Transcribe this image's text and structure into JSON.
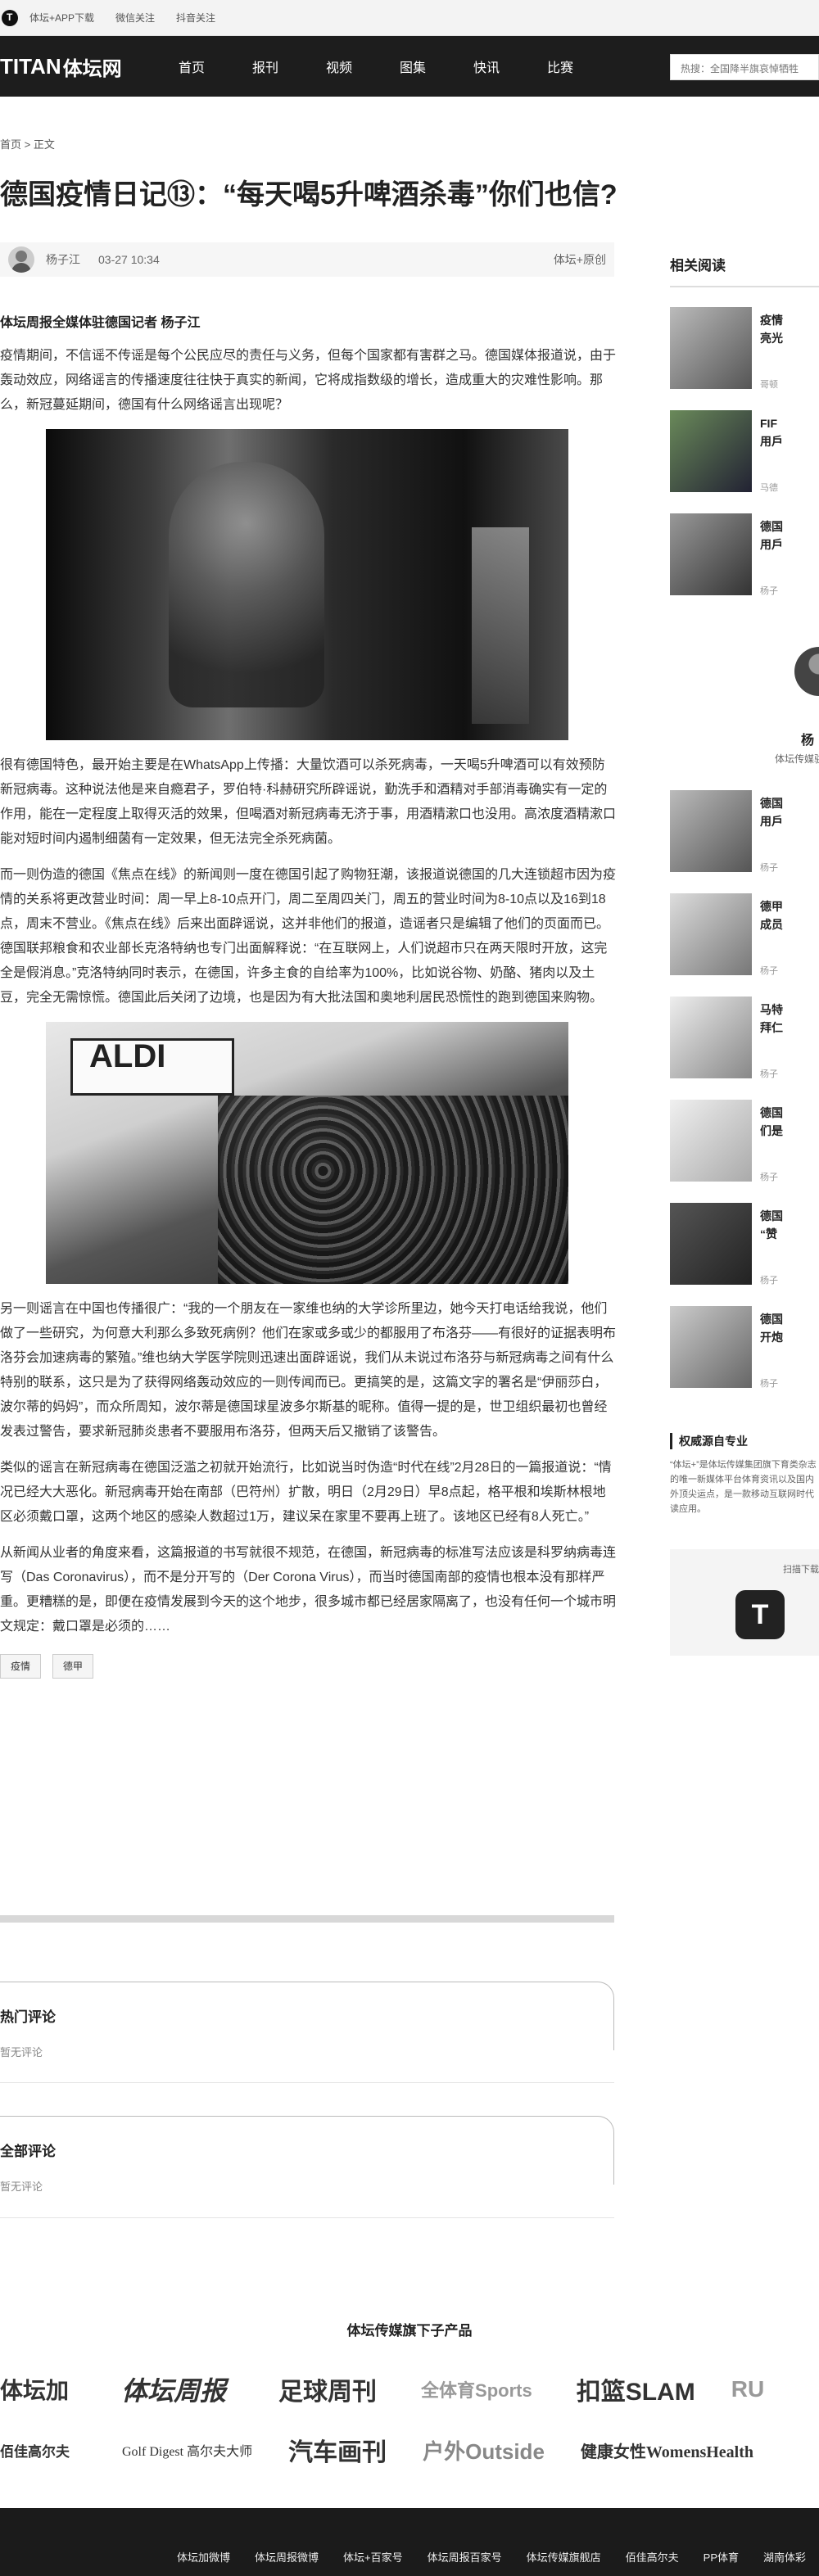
{
  "topbar": {
    "links": [
      "体坛+APP下载",
      "微信关注",
      "抖音关注"
    ]
  },
  "nav": {
    "brand_en": "TITAN",
    "brand_cn": "体坛网",
    "items": [
      "首页",
      "报刊",
      "视频",
      "图集",
      "快讯",
      "比赛"
    ],
    "search_placeholder": "热搜：全国降半旗哀悼牺牲"
  },
  "breadcrumb": "首页 > 正文",
  "article": {
    "title": "德国疫情日记⑬：“每天喝5升啤酒杀毒”你们也信?",
    "author": "杨子江",
    "time": "03-27 10:34",
    "source": "体坛+原创",
    "lead": "体坛周报全媒体驻德国记者 杨子江",
    "paragraphs": [
      "疫情期间，不信谣不传谣是每个公民应尽的责任与义务，但每个国家都有害群之马。德国媒体报道说，由于轰动效应，网络谣言的传播速度往往快于真实的新闻，它将成指数级的增长，造成重大的灾难性影响。那么，新冠蔓延期间，德国有什么网络谣言出现呢？",
      "很有德国特色，最开始主要是在WhatsApp上传播：大量饮酒可以杀死病毒，一天喝5升啤酒可以有效预防新冠病毒。这种说法他是来自瘾君子，罗伯特·科赫研究所辟谣说，勤洗手和酒精对手部消毒确实有一定的作用，能在一定程度上取得灭活的效果，但喝酒对新冠病毒无济于事，用酒精漱口也没用。高浓度酒精漱口能对短时间内遏制细菌有一定效果，但无法完全杀死病菌。",
      "而一则伪造的德国《焦点在线》的新闻则一度在德国引起了购物狂潮，该报道说德国的几大连锁超市因为疫情的关系将更改营业时间：周一早上8-10点开门，周二至周四关门，周五的营业时间为8-10点以及16到18点，周末不营业。《焦点在线》后来出面辟谣说，这并非他们的报道，造谣者只是编辑了他们的页面而已。德国联邦粮食和农业部长克洛特纳也专门出面解释说：“在互联网上，人们说超市只在两天限时开放，这完全是假消息。”克洛特纳同时表示，在德国，许多主食的自给率为100%，比如说谷物、奶酪、猪肉以及土豆，完全无需惊慌。德国此后关闭了边境，也是因为有大批法国和奥地利居民恐慌性的跑到德国来购物。",
      "另一则谣言在中国也传播很广：“我的一个朋友在一家维也纳的大学诊所里边，她今天打电话给我说，他们做了一些研究，为何意大利那么多致死病例？他们在家或多或少的都服用了布洛芬——有很好的证据表明布洛芬会加速病毒的繁殖。”维也纳大学医学院则迅速出面辟谣说，我们从未说过布洛芬与新冠病毒之间有什么特别的联系，这只是为了获得网络轰动效应的一则传闻而已。更搞笑的是，这篇文字的署名是“伊丽莎白，波尔蒂的妈妈”，而众所周知，波尔蒂是德国球星波多尔斯基的昵称。值得一提的是，世卫组织最初也曾经发表过警告，要求新冠肺炎患者不要服用布洛芬，但两天后又撤销了该警告。",
      "类似的谣言在新冠病毒在德国泛滥之初就开始流行，比如说当时伪造“时代在线”2月28日的一篇报道说：“情况已经大大恶化。新冠病毒开始在南部（巴符州）扩散，明日（2月29日）早8点起，格平根和埃斯林根地区必须戴口罩，这两个地区的感染人数超过1万，建议呆在家里不要再上班了。该地区已经有8人死亡。”",
      "从新闻从业者的角度来看，这篇报道的书写就很不规范，在德国，新冠病毒的标准写法应该是科罗纳病毒连写（Das Coronavirus），而不是分开写的（Der Corona Virus），而当时德国南部的疫情也根本没有那样严重。更糟糕的是，即便在疫情发展到今天的这个地步，很多城市都已经居家隔离了，也没有任何一个城市明文规定：戴口罩是必须的……"
    ],
    "photo2_sign": "ALDI",
    "tags": [
      "疫情",
      "德甲"
    ]
  },
  "comments": {
    "hot_title": "热门评论",
    "hot_empty": "暂无评论",
    "all_title": "全部评论",
    "all_empty": "暂无评论"
  },
  "sidebar": {
    "title": "相关阅读",
    "items": [
      {
        "text": "疫情",
        "text2": "亮光",
        "sub": "哥顿"
      },
      {
        "text": "FIF",
        "text2": "用戶",
        "sub": "马德"
      },
      {
        "text": "德国",
        "text2": "用戶",
        "sub": "杨子"
      }
    ],
    "profile_name": "杨",
    "profile_desc": "体坛传媒驻",
    "more": [
      {
        "text": "德国",
        "text2": "用戶",
        "sub": "杨子"
      },
      {
        "text": "德甲",
        "text2": "成员",
        "sub": "杨子"
      },
      {
        "text": "马特",
        "text2": "拜仁",
        "sub": "杨子"
      },
      {
        "text": "德国",
        "text2": "们是",
        "sub": "杨子"
      },
      {
        "text": "德国",
        "text2": "“赞",
        "sub": "杨子"
      },
      {
        "text": "德国",
        "text2": "开炮",
        "sub": "杨子"
      }
    ],
    "auth_title": "权威源自专业",
    "auth_desc": "“体坛+”是体坛传媒集团旗下育类杂志的唯一新媒体平台体育资讯以及国内外顶尖运点，是一款移动互联网时代读应用。",
    "qr_label": "扫描下载",
    "qr_icon": "T"
  },
  "brands": {
    "title": "体坛传媒旗下子产品",
    "row1": [
      "体坛加",
      "体坛周报",
      "足球周刊",
      "全体育Sports",
      "扣篮SLAM",
      "RU"
    ],
    "row2": [
      "佰佳高尔夫",
      "Golf Digest 高尔夫大师",
      "汽车画刊",
      "户外Outside",
      "健康女性WomensHealth"
    ]
  },
  "footer": {
    "links": [
      "体坛加微博",
      "体坛周报微博",
      "体坛+百家号",
      "体坛周报百家号",
      "体坛传媒旗舰店",
      "佰佳高尔夫",
      "PP体育",
      "湖南体彩"
    ]
  }
}
